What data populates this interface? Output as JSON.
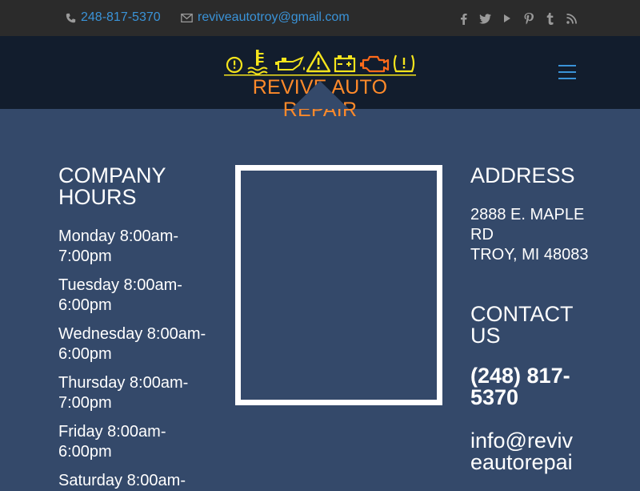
{
  "topbar": {
    "phone": "248-817-5370",
    "email": "reviveautotroy@gmail.com",
    "phone_icon": "phone-icon",
    "email_icon": "envelope-icon",
    "social": [
      "facebook-icon",
      "twitter-icon",
      "youtube-icon",
      "pinterest-icon",
      "tumblr-icon",
      "rss-icon"
    ]
  },
  "header": {
    "logo_text": "REVIVE AUTO REPAIR",
    "logo_icons": [
      "tire-pressure-icon",
      "coolant-temp-icon",
      "oil-can-icon",
      "warning-triangle-icon",
      "battery-icon",
      "engine-icon",
      "tpms-icon"
    ],
    "menu_icon": "hamburger-menu-icon"
  },
  "hours": {
    "heading": "COMPANY HOURS",
    "days": [
      "Monday 8:00am-7:00pm",
      "Tuesday 8:00am-6:00pm",
      "Wednesday 8:00am-6:00pm",
      "Thursday 8:00am-7:00pm",
      "Friday 8:00am-6:00pm",
      "Saturday 8:00am-"
    ]
  },
  "address": {
    "heading": "ADDRESS",
    "line1": "2888 E. MAPLE RD",
    "line2": "TROY, MI 48083"
  },
  "contact": {
    "heading": "CONTACT US",
    "phone": "(248) 817-5370",
    "email": "info@reviveautorepai"
  },
  "colors": {
    "topbar_bg": "#2b2b2b",
    "header_bg": "#121d2d",
    "page_bg": "#34496a",
    "link": "#3a93d8",
    "logo_orange": "#ff8a2a",
    "logo_yellow": "#f5e41c"
  }
}
